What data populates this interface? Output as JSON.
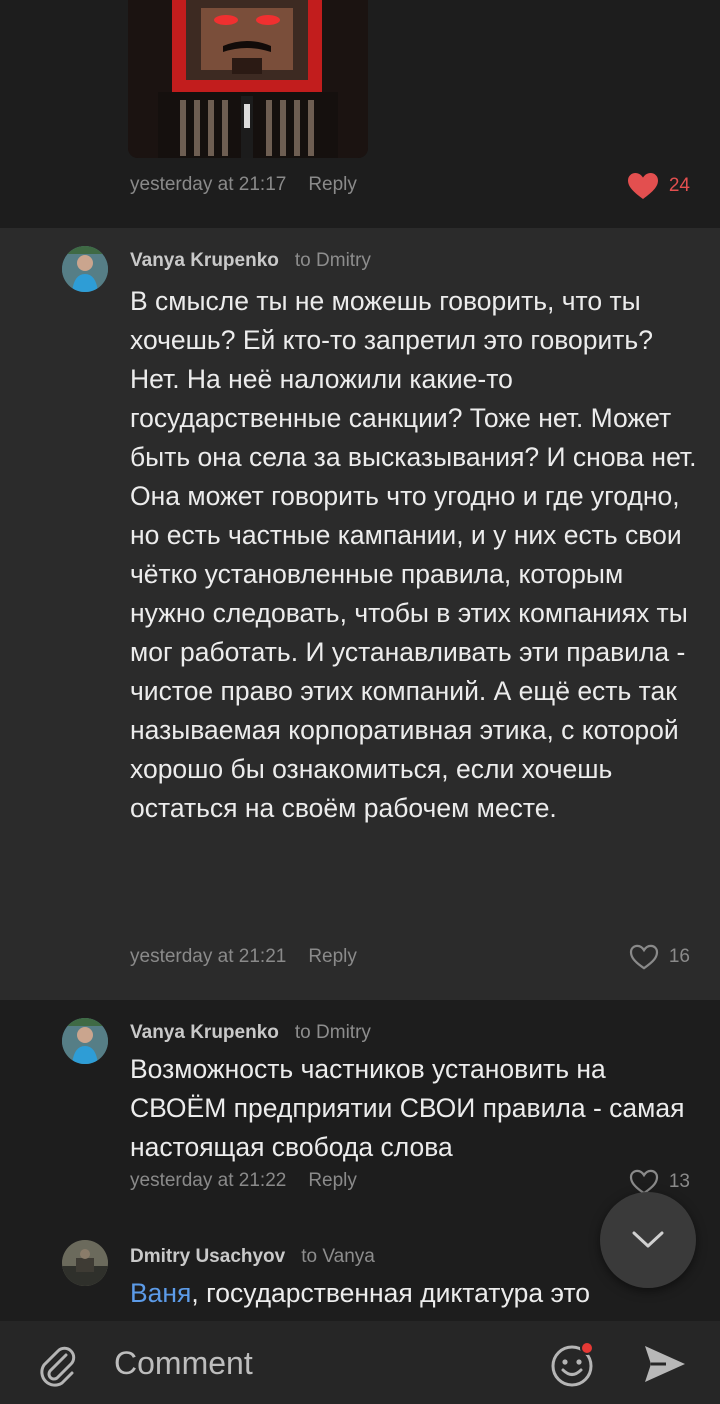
{
  "comments": [
    {
      "timestamp": "yesterday at 21:17",
      "reply_label": "Reply",
      "likes": "24"
    },
    {
      "author": "Vanya Krupenko",
      "to": "to Dmitry",
      "text": "В смысле ты не можешь говорить, что ты хочешь? Ей кто-то запретил это говорить? Нет. На неё наложили какие-то государственные санкции? Тоже нет. Может быть она села за высказывания? И снова нет. Она может говорить что угодно и где угодно, но есть частные кампании, и у них есть свои чётко установленные правила, которым нужно следовать, чтобы в этих компаниях ты мог работать. И устанавливать эти правила - чистое право этих компаний. А ещё есть так называемая корпоративная этика, с которой хорошо бы ознакомиться, если хочешь остаться на своём рабочем месте.",
      "timestamp": "yesterday at 21:21",
      "reply_label": "Reply",
      "likes": "16"
    },
    {
      "author": "Vanya Krupenko",
      "to": "to Dmitry",
      "text": "Возможность частников установить на СВОЁМ предприятии СВОИ правила - самая настоящая свобода слова",
      "timestamp": "yesterday at 21:22",
      "reply_label": "Reply",
      "likes": "13"
    },
    {
      "author": "Dmitry Usachyov",
      "to": "to Vanya",
      "mention": "Ваня",
      "text": ", государственная диктатура это"
    }
  ],
  "composer": {
    "placeholder": "Comment"
  },
  "icons": {
    "attach": "paperclip-icon",
    "emoji": "emoji-icon",
    "send": "send-icon",
    "scroll": "chevron-down-icon",
    "like": "heart-icon"
  },
  "colors": {
    "like_active": "#e34f4f",
    "mention": "#5c9be8",
    "notification_dot": "#e53935"
  }
}
